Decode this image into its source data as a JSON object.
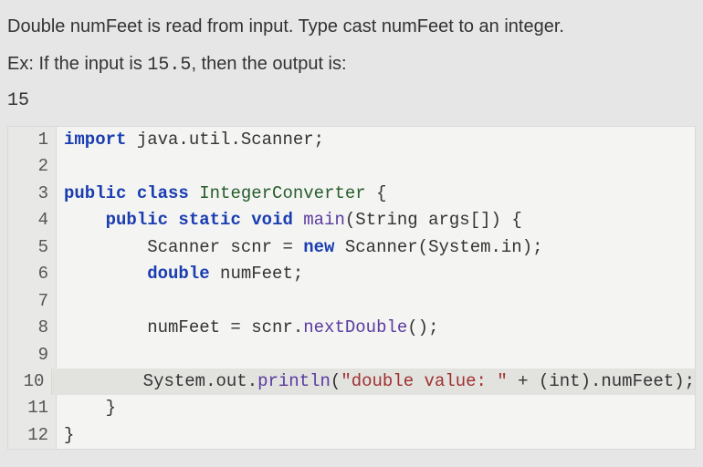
{
  "problem": {
    "line1": "Double numFeet is read from input. Type cast numFeet to an integer.",
    "line2_prefix": "Ex: If the input is ",
    "line2_input": "15.5",
    "line2_suffix": ", then the output is:",
    "expected_output": "15"
  },
  "code": {
    "lines": [
      {
        "n": "1",
        "import_kw": "import",
        "pkg": " java.util.Scanner;"
      },
      {
        "n": "2",
        "blank": ""
      },
      {
        "n": "3",
        "pub": "public",
        "cls_kw": " class",
        "cls_name": " IntegerConverter",
        "brace": " {"
      },
      {
        "n": "4",
        "indent": "    ",
        "pub": "public",
        "static": " static",
        "void": " void",
        "main": " main",
        "args": "(String args[]) {"
      },
      {
        "n": "5",
        "indent": "        ",
        "scanner1": "Scanner scnr = ",
        "new": "new",
        "scanner2": " Scanner(System.in);"
      },
      {
        "n": "6",
        "indent": "        ",
        "dbl": "double",
        "decl": " numFeet;"
      },
      {
        "n": "7",
        "blank": ""
      },
      {
        "n": "8",
        "indent": "        ",
        "assign": "numFeet = scnr.",
        "next": "nextDouble",
        "tail": "();"
      },
      {
        "n": "9",
        "blank": ""
      },
      {
        "n": "10",
        "indent": "        ",
        "sys": "System.out.",
        "println": "println",
        "paren": "(",
        "str": "\"double value: \"",
        "rest": " + (int).numFeet);"
      },
      {
        "n": "11",
        "indent": "    ",
        "brace": "}"
      },
      {
        "n": "12",
        "brace": "}"
      }
    ]
  }
}
